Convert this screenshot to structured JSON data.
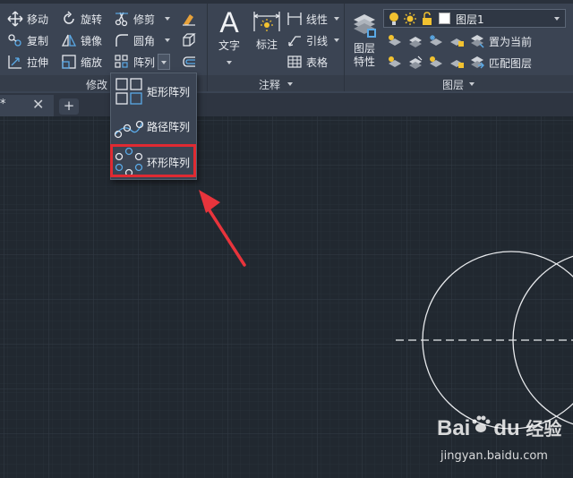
{
  "modify_panel": {
    "title": "修改",
    "move": "移动",
    "rotate": "旋转",
    "trim": "修剪",
    "copy": "复制",
    "mirror": "镜像",
    "fillet": "圆角",
    "stretch": "拉伸",
    "scale": "缩放",
    "array": "阵列"
  },
  "annotation_panel": {
    "title": "注释",
    "text": "文字",
    "dimension": "标注",
    "linear": "线性",
    "leader": "引线",
    "table": "表格"
  },
  "layers_panel": {
    "title": "图层",
    "layer_properties_line1": "图层",
    "layer_properties_line2": "特性",
    "current_layer": "图层1",
    "set_current": "置为当前",
    "match_layer": "匹配图层"
  },
  "file_tab": {
    "modified_marker": "*",
    "close_glyph": "✕",
    "new_tab_glyph": "+"
  },
  "array_dropdown": {
    "items": [
      {
        "label": "矩形阵列",
        "icon": "rectangular-array-icon"
      },
      {
        "label": "路径阵列",
        "icon": "path-array-icon"
      },
      {
        "label": "环形阵列",
        "icon": "polar-array-icon",
        "highlighted": true
      }
    ]
  },
  "watermark": {
    "brand": "Bai",
    "brand2": "du",
    "product": "经验",
    "url": "jingyan.baidu.com"
  },
  "colors": {
    "ribbon_bg": "#3b4453",
    "canvas_bg": "#212830",
    "highlight_box": "#e02a32",
    "annotation_arrow": "#e8343c",
    "icon_blue": "#5aa9e6",
    "icon_yellow": "#f2c230"
  }
}
